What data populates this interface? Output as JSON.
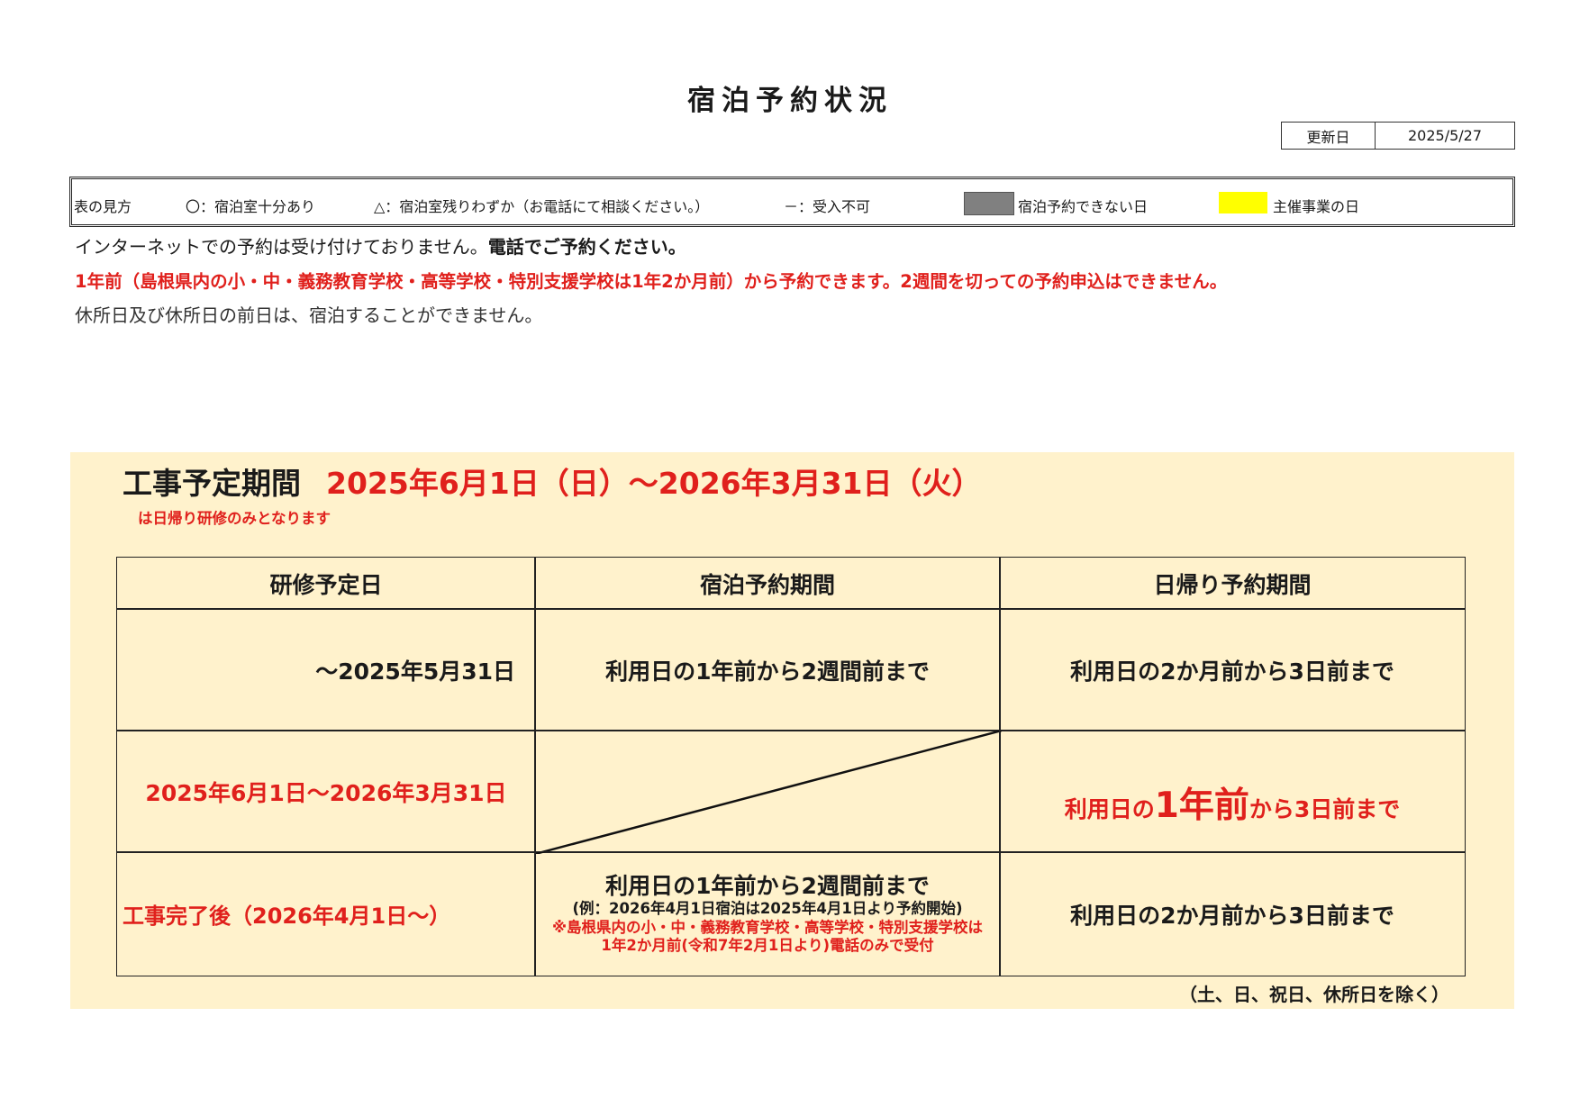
{
  "title": "宿泊予約状況",
  "update": {
    "label": "更新日",
    "value": "2025/5/27"
  },
  "legend": {
    "heading": "表の見方",
    "available": "〇：宿泊室十分あり",
    "few": "△：宿泊室残りわずか（お電話にて相談ください。）",
    "unavailable": "－：受入不可",
    "no_stay_label": "宿泊予約できない日",
    "event_label": "主催事業の日",
    "colors": {
      "no_stay": "#808080",
      "event": "#ffff00"
    }
  },
  "notes": {
    "internet_part1": "インターネットでの予約は受け付けておりません。",
    "internet_part2": "電話でご予約ください。",
    "advance": "1年前（島根県内の小・中・義務教育学校・高等学校・特別支援学校は1年2か月前）から予約できます。2週間を切っての予約申込はできません。",
    "closed": "休所日及び休所日の前日は、宿泊することができません。"
  },
  "construction": {
    "label": "工事予定期間",
    "dates": "2025年6月1日（日）～2026年3月31日（火）",
    "note": "は日帰り研修のみとなります"
  },
  "table": {
    "headers": [
      "研修予定日",
      "宿泊予約期間",
      "日帰り予約期間"
    ],
    "row1": {
      "date": "～2025年5月31日",
      "stay": "利用日の1年前から2週間前まで",
      "day": "利用日の2か月前から3日前まで"
    },
    "row2": {
      "date": "2025年6月1日～2026年3月31日",
      "day_pre": "利用日の",
      "day_big": "1年前",
      "day_post": "から3日前まで"
    },
    "row3": {
      "date": "工事完了後（2026年4月1日～）",
      "stay_main": "利用日の1年前から2週間前まで",
      "stay_example": "(例：2026年4月1日宿泊は2025年4月1日より予約開始)",
      "stay_note1": "※島根県内の小・中・義務教育学校・高等学校・特別支援学校は",
      "stay_note2": "1年2か月前(令和7年2月1日より)電話のみで受付",
      "day": "利用日の2か月前から3日前まで"
    },
    "footnote": "（土、日、祝日、休所日を除く）"
  }
}
